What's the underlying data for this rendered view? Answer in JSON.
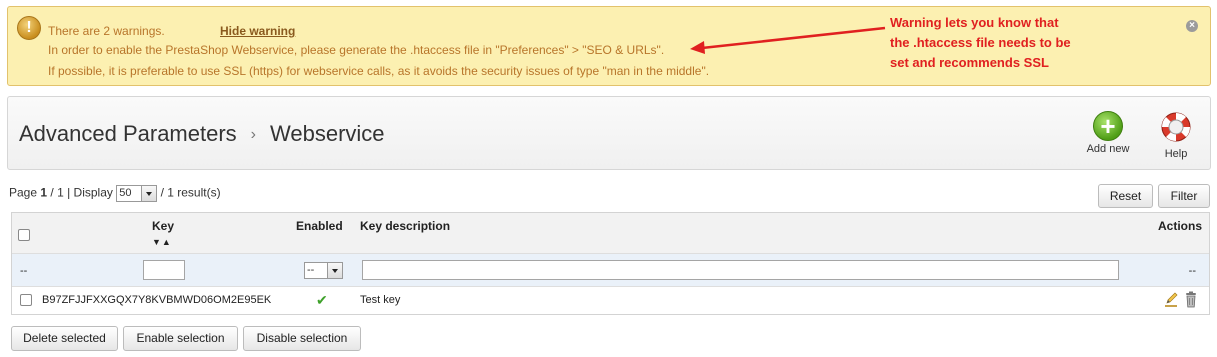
{
  "warning": {
    "count_text": "There are 2 warnings.",
    "hide_label": "Hide warning",
    "line2": "In order to enable the PrestaShop Webservice, please generate the .htaccess file in \"Preferences\" > \"SEO & URLs\".",
    "line3": "If possible, it is preferable to use SSL (https) for webservice calls, as it avoids the security issues of type \"man in the middle\".",
    "close": "×",
    "icon": "warning-icon"
  },
  "annotation": {
    "line1": "Warning lets you know that",
    "line2": "the .htaccess file needs to be",
    "line3": "set and recommends SSL",
    "color": "#e02020"
  },
  "header": {
    "breadcrumb_parent": "Advanced Parameters",
    "separator": "›",
    "title": "Webservice",
    "add_new_label": "Add new",
    "help_label": "Help"
  },
  "pagination": {
    "page_label": "Page",
    "current_page": "1",
    "total_pages": "/ 1 | Display",
    "per_page": "50",
    "results": "/ 1 result(s)"
  },
  "filters": {
    "reset_label": "Reset",
    "filter_label": "Filter"
  },
  "table": {
    "columns": {
      "key": "Key",
      "enabled": "Enabled",
      "description": "Key description",
      "actions": "Actions"
    },
    "sort_arrows": "▼▲",
    "filter_row": {
      "dash": "--",
      "enabled_select": "--",
      "actions_dash": "--"
    },
    "rows": [
      {
        "key": "B97ZFJJFXXGQX7Y8KVBMWD06OM2E95EK",
        "enabled": "✔",
        "description": "Test key"
      }
    ]
  },
  "bulk": {
    "delete_label": "Delete selected",
    "enable_label": "Enable selection",
    "disable_label": "Disable selection"
  },
  "colors": {
    "warning_bg": "#fcf0b1",
    "warning_text": "#b8752a",
    "enabled_check": "#3ea12a",
    "annotation_red": "#e02020"
  }
}
